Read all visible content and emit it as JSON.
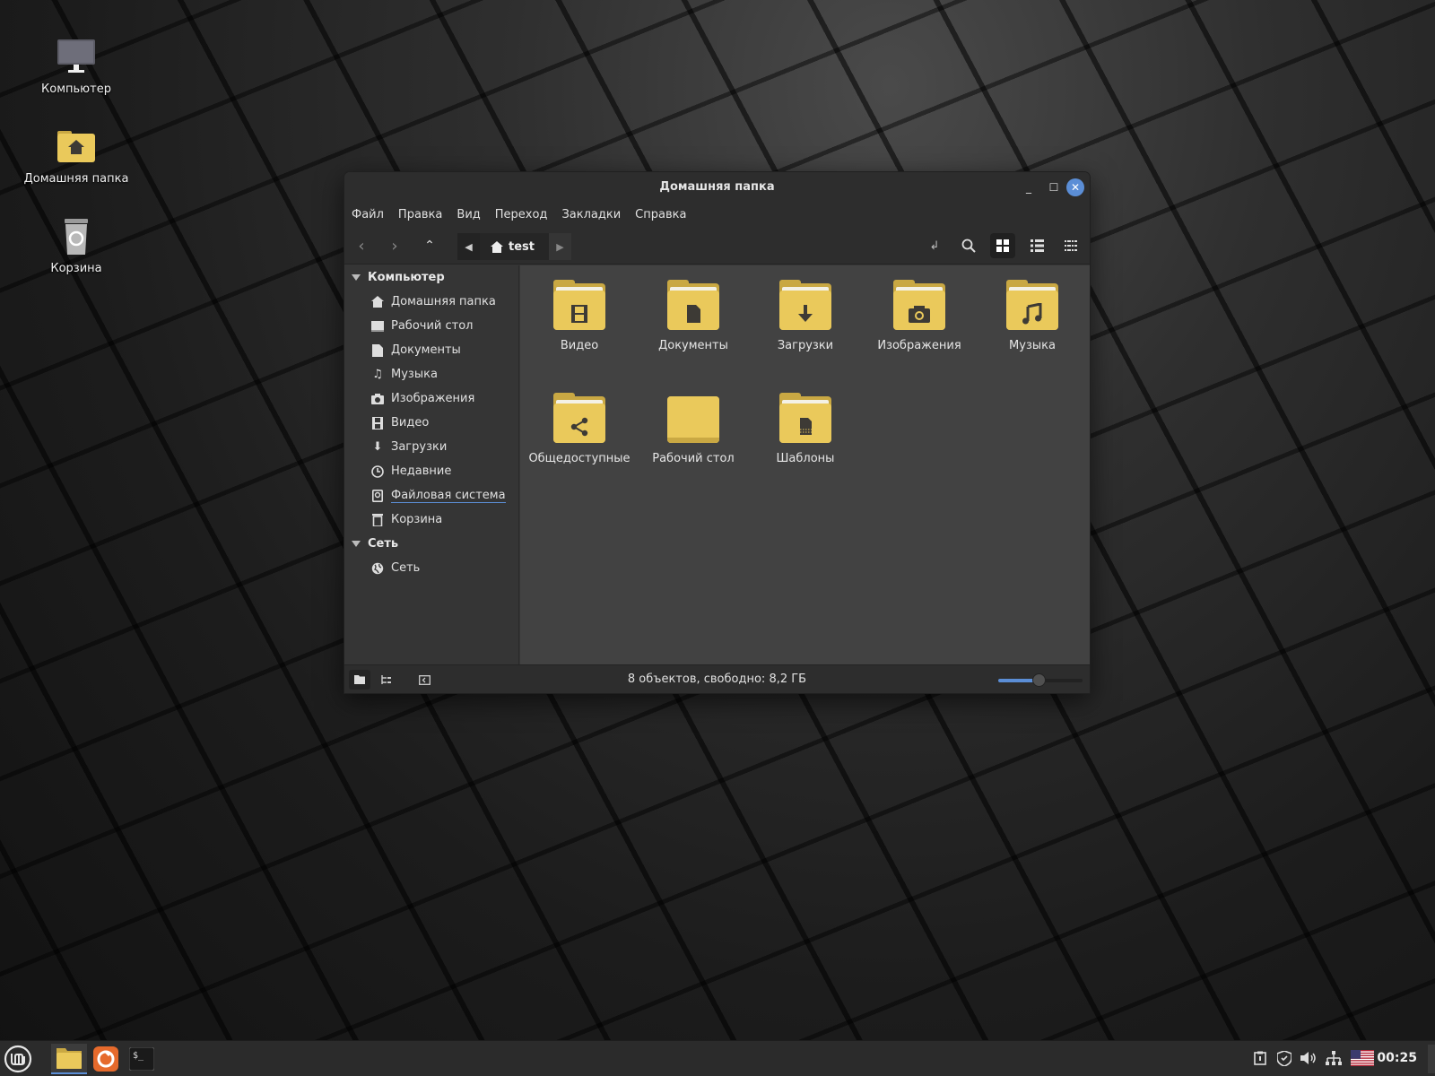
{
  "desktop": {
    "icons": [
      {
        "label": "Компьютер",
        "icon": "monitor-icon"
      },
      {
        "label": "Домашняя папка",
        "icon": "home-folder-icon"
      },
      {
        "label": "Корзина",
        "icon": "trash-icon"
      }
    ]
  },
  "window": {
    "title": "Домашняя папка",
    "menu": [
      "Файл",
      "Правка",
      "Вид",
      "Переход",
      "Закладки",
      "Справка"
    ],
    "path": {
      "current": "test"
    },
    "sidebar": {
      "sections": [
        {
          "heading": "Компьютер",
          "items": [
            {
              "label": "Домашняя папка",
              "icon": "home-icon"
            },
            {
              "label": "Рабочий стол",
              "icon": "desktop-icon"
            },
            {
              "label": "Документы",
              "icon": "document-icon"
            },
            {
              "label": "Музыка",
              "icon": "music-icon"
            },
            {
              "label": "Изображения",
              "icon": "camera-icon"
            },
            {
              "label": "Видео",
              "icon": "film-icon"
            },
            {
              "label": "Загрузки",
              "icon": "download-icon"
            },
            {
              "label": "Недавние",
              "icon": "clock-icon"
            },
            {
              "label": "Файловая система",
              "icon": "drive-icon"
            },
            {
              "label": "Корзина",
              "icon": "trash-icon"
            }
          ]
        },
        {
          "heading": "Сеть",
          "items": [
            {
              "label": "Сеть",
              "icon": "globe-icon"
            }
          ]
        }
      ]
    },
    "files": [
      {
        "name": "Видео",
        "icon": "film-icon"
      },
      {
        "name": "Документы",
        "icon": "document-icon"
      },
      {
        "name": "Загрузки",
        "icon": "download-icon"
      },
      {
        "name": "Изображения",
        "icon": "camera-icon"
      },
      {
        "name": "Музыка",
        "icon": "music-icon"
      },
      {
        "name": "Общедоступные",
        "icon": "share-icon"
      },
      {
        "name": "Рабочий стол",
        "icon": "plain-folder-icon"
      },
      {
        "name": "Шаблоны",
        "icon": "template-icon"
      }
    ],
    "status": "8 объектов, свободно: 8,2 ГБ",
    "zoom_level": 0.48,
    "view_mode": "icons"
  },
  "taskbar": {
    "clock": "00:25",
    "apps": [
      "menu-icon",
      "file-manager-icon",
      "firefox-icon",
      "terminal-icon"
    ],
    "tray": [
      "clipboard-icon",
      "shield-icon",
      "volume-icon",
      "network-icon",
      "us-flag-icon"
    ],
    "accent": "#5b8ed6"
  }
}
